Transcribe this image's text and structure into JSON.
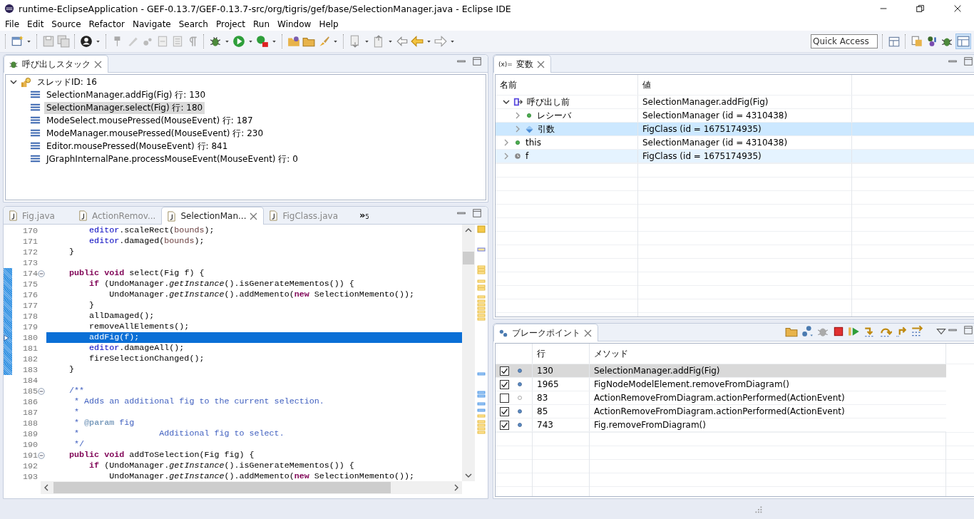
{
  "window": {
    "title": "runtime-EclipseApplication - GEF-0.13.7/GEF-0.13.7-src/org/tigris/gef/base/SelectionManager.java - Eclipse IDE"
  },
  "menu": [
    "File",
    "Edit",
    "Source",
    "Refactor",
    "Navigate",
    "Search",
    "Project",
    "Run",
    "Window",
    "Help"
  ],
  "quick_access": {
    "placeholder": "Quick Access"
  },
  "call_stack": {
    "title": "呼び出しスタック",
    "thread": {
      "label": "スレッドID: 16",
      "expanded": true,
      "children": [
        {
          "label": "SelectionManager.addFig(Fig) 行: 130",
          "selected": false
        },
        {
          "label": "SelectionManager.select(Fig) 行: 180",
          "selected": true
        },
        {
          "label": "ModeSelect.mousePressed(MouseEvent) 行: 187",
          "selected": false
        },
        {
          "label": "ModeManager.mousePressed(MouseEvent) 行: 230",
          "selected": false
        },
        {
          "label": "Editor.mousePressed(MouseEvent) 行: 841",
          "selected": false
        },
        {
          "label": "JGraphInternalPane.processMouseEvent(MouseEvent) 行: 0",
          "selected": false
        }
      ]
    }
  },
  "editor": {
    "tabs": [
      {
        "label": "Fig.java",
        "selected": false
      },
      {
        "label": "ActionRemov...",
        "selected": false
      },
      {
        "label": "SelectionMan...",
        "selected": true
      },
      {
        "label": "FigClass.java",
        "selected": false
      }
    ],
    "overflow": {
      "label": "»",
      "count": "5"
    },
    "lines": [
      {
        "number": "170",
        "fold": false,
        "in_range": false,
        "current": false,
        "tokens": [
          {
            "kind": "field",
            "text": "        editor"
          },
          {
            "kind": "plain",
            "text": ".scaleRect("
          },
          {
            "kind": "local",
            "text": "bounds"
          },
          {
            "kind": "plain",
            "text": ");"
          }
        ]
      },
      {
        "number": "171",
        "fold": false,
        "in_range": false,
        "current": false,
        "tokens": [
          {
            "kind": "field",
            "text": "        editor"
          },
          {
            "kind": "plain",
            "text": ".damaged("
          },
          {
            "kind": "local",
            "text": "bounds"
          },
          {
            "kind": "plain",
            "text": ");"
          }
        ]
      },
      {
        "number": "172",
        "fold": false,
        "in_range": false,
        "current": false,
        "tokens": [
          {
            "kind": "plain",
            "text": "    }"
          }
        ]
      },
      {
        "number": "173",
        "fold": false,
        "in_range": false,
        "current": false
      },
      {
        "number": "174",
        "fold": true,
        "in_range": true,
        "current": false,
        "tokens": [
          {
            "kind": "kw",
            "text": "    public void"
          },
          {
            "kind": "plain",
            "text": " select(Fig f) {"
          }
        ]
      },
      {
        "number": "175",
        "fold": false,
        "in_range": true,
        "current": false,
        "tokens": [
          {
            "kind": "kw",
            "text": "        if"
          },
          {
            "kind": "plain",
            "text": " (UndoManager."
          },
          {
            "kind": "static",
            "text": "getInstance"
          },
          {
            "kind": "plain",
            "text": "().isGenerateMementos()) {"
          }
        ]
      },
      {
        "number": "176",
        "fold": false,
        "in_range": true,
        "current": false,
        "tokens": [
          {
            "kind": "plain",
            "text": "            UndoManager."
          },
          {
            "kind": "static",
            "text": "getInstance"
          },
          {
            "kind": "plain",
            "text": "().addMemento("
          },
          {
            "kind": "kw",
            "text": "new"
          },
          {
            "kind": "plain",
            "text": " SelectionMemento());"
          }
        ]
      },
      {
        "number": "177",
        "fold": false,
        "in_range": true,
        "current": false,
        "tokens": [
          {
            "kind": "plain",
            "text": "        }"
          }
        ]
      },
      {
        "number": "178",
        "fold": false,
        "in_range": true,
        "current": false,
        "tokens": [
          {
            "kind": "plain",
            "text": "        allDamaged();"
          }
        ]
      },
      {
        "number": "179",
        "fold": false,
        "in_range": true,
        "current": false,
        "tokens": [
          {
            "kind": "plain",
            "text": "        removeAllElements();"
          }
        ]
      },
      {
        "number": "180",
        "fold": false,
        "in_range": true,
        "current": true,
        "tokens": [
          {
            "kind": "plain",
            "text": "        addFig(f);"
          }
        ]
      },
      {
        "number": "181",
        "fold": false,
        "in_range": true,
        "current": false,
        "tokens": [
          {
            "kind": "field",
            "text": "        editor"
          },
          {
            "kind": "plain",
            "text": ".damageAll();"
          }
        ]
      },
      {
        "number": "182",
        "fold": false,
        "in_range": true,
        "current": false,
        "tokens": [
          {
            "kind": "plain",
            "text": "        fireSelectionChanged();"
          }
        ]
      },
      {
        "number": "183",
        "fold": false,
        "in_range": true,
        "current": false,
        "tokens": [
          {
            "kind": "plain",
            "text": "    }"
          }
        ]
      },
      {
        "number": "184",
        "fold": false,
        "in_range": false,
        "current": false
      },
      {
        "number": "185",
        "fold": true,
        "in_range": false,
        "current": false,
        "tokens": [
          {
            "kind": "doc",
            "text": "    /**"
          }
        ]
      },
      {
        "number": "186",
        "fold": false,
        "in_range": false,
        "current": false,
        "tokens": [
          {
            "kind": "doc",
            "text": "     * Adds an additional fig to the current selection."
          }
        ]
      },
      {
        "number": "187",
        "fold": false,
        "in_range": false,
        "current": false,
        "tokens": [
          {
            "kind": "doc",
            "text": "     *"
          }
        ]
      },
      {
        "number": "188",
        "fold": false,
        "in_range": false,
        "current": false,
        "tokens": [
          {
            "kind": "doc",
            "text": "     * "
          },
          {
            "kind": "tag",
            "text": "@param"
          },
          {
            "kind": "doc",
            "text": " fig"
          }
        ]
      },
      {
        "number": "189",
        "fold": false,
        "in_range": false,
        "current": false,
        "tokens": [
          {
            "kind": "doc",
            "text": "     *                Additional fig to select."
          }
        ]
      },
      {
        "number": "190",
        "fold": false,
        "in_range": false,
        "current": false,
        "tokens": [
          {
            "kind": "doc",
            "text": "     */"
          }
        ]
      },
      {
        "number": "191",
        "fold": true,
        "in_range": false,
        "current": false,
        "tokens": [
          {
            "kind": "kw",
            "text": "    public void"
          },
          {
            "kind": "plain",
            "text": " addToSelection(Fig fig) {"
          }
        ]
      },
      {
        "number": "192",
        "fold": false,
        "in_range": false,
        "current": false,
        "tokens": [
          {
            "kind": "kw",
            "text": "        if"
          },
          {
            "kind": "plain",
            "text": " (UndoManager."
          },
          {
            "kind": "static",
            "text": "getInstance"
          },
          {
            "kind": "plain",
            "text": "().isGenerateMementos()) {"
          }
        ]
      },
      {
        "number": "193",
        "fold": false,
        "in_range": false,
        "current": false,
        "tokens": [
          {
            "kind": "plain",
            "text": "            UndoManager."
          },
          {
            "kind": "static",
            "text": "getInstance"
          },
          {
            "kind": "plain",
            "text": "().addMemento("
          },
          {
            "kind": "kw",
            "text": "new"
          },
          {
            "kind": "plain",
            "text": " SelectionMemento());"
          }
        ]
      }
    ]
  },
  "variables": {
    "title": "変数",
    "title_prefix": "(x)=",
    "columns": [
      "名前",
      "値"
    ],
    "rows": [
      {
        "name": "呼び出し前",
        "value": "SelectionManager.addFig(Fig)",
        "kind": "return",
        "expanded": true,
        "selected": false,
        "hover": false,
        "children": [
          {
            "name": "レシーバ",
            "value": "SelectionManager (id = 4310438)",
            "kind": "field",
            "expanded": false,
            "selected": false,
            "hover": false
          },
          {
            "name": "引数",
            "value": "FigClass (id = 1675174935)",
            "kind": "argument",
            "expanded": false,
            "selected": true,
            "hover": false
          }
        ]
      },
      {
        "name": "this",
        "value": "SelectionManager (id = 4310438)",
        "kind": "field",
        "expanded": false,
        "selected": false,
        "hover": false
      },
      {
        "name": "f",
        "value": "FigClass (id = 1675174935)",
        "kind": "local",
        "expanded": false,
        "selected": false,
        "hover": true
      }
    ]
  },
  "breakpoints": {
    "title": "ブレークポイント",
    "columns": [
      "行",
      "メソッド"
    ],
    "rows": [
      {
        "checked": true,
        "line": "130",
        "method": "SelectionManager.addFig(Fig)",
        "selected": true
      },
      {
        "checked": true,
        "line": "1965",
        "method": "FigNodeModelElement.removeFromDiagram()",
        "selected": false
      },
      {
        "checked": false,
        "line": "83",
        "method": "ActionRemoveFromDiagram.actionPerformed(ActionEvent)",
        "selected": false
      },
      {
        "checked": true,
        "line": "85",
        "method": "ActionRemoveFromDiagram.actionPerformed(ActionEvent)",
        "selected": false
      },
      {
        "checked": true,
        "line": "743",
        "method": "Fig.removeFromDiagram()",
        "selected": false
      }
    ]
  }
}
